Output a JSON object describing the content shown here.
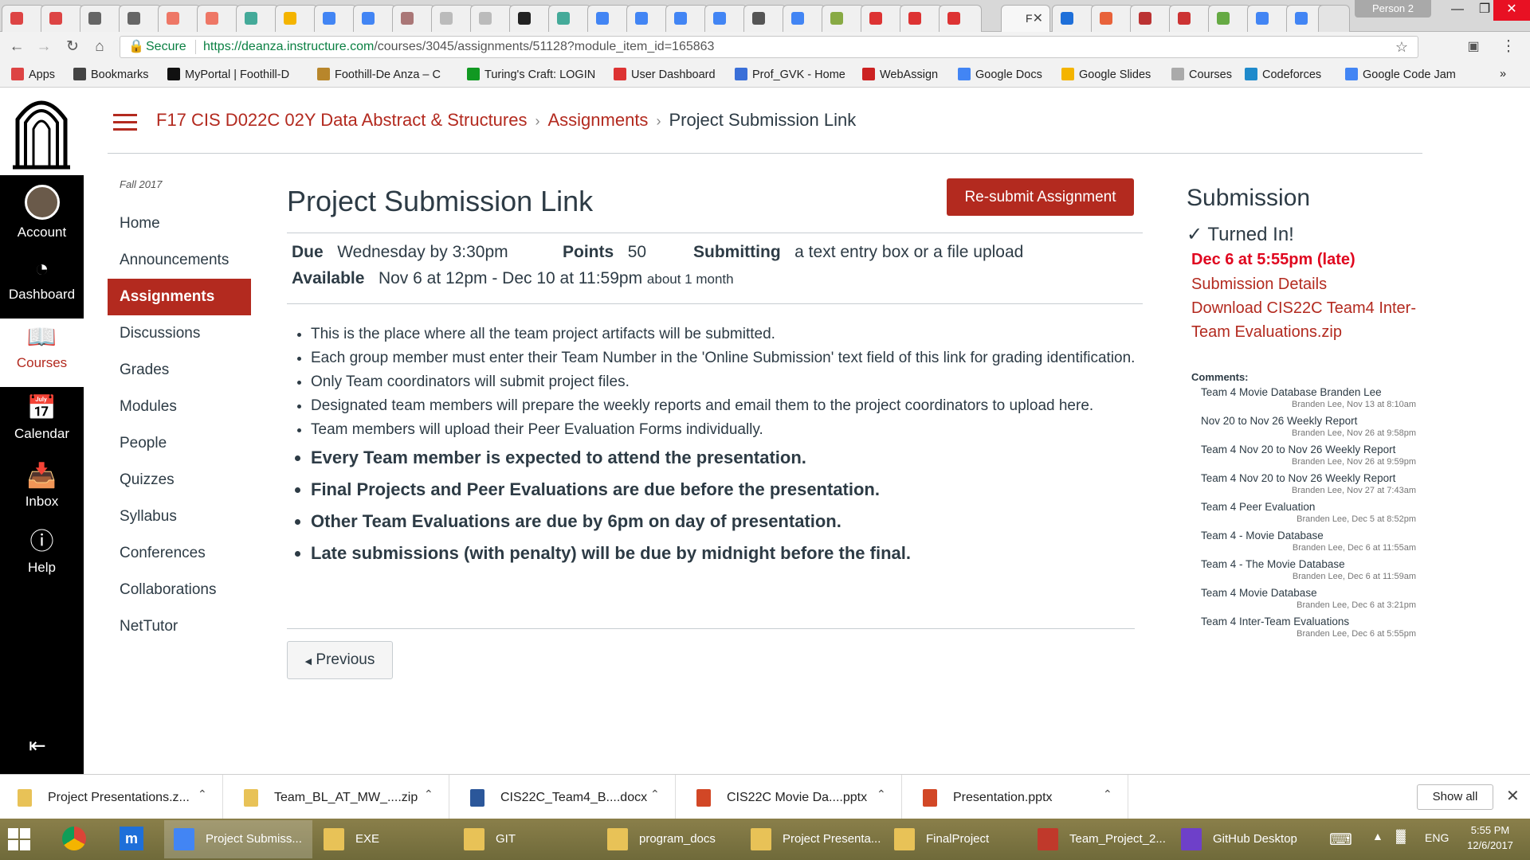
{
  "browser": {
    "active_tab_title": "F",
    "profile": "Person 2",
    "url_host": "https://deanza.instructure.com",
    "url_path": "/courses/3045/assignments/51128?module_item_id=165863",
    "secure_label": "Secure"
  },
  "bookmarks": [
    {
      "label": "Apps",
      "icon": "apps-grid-icon",
      "color": "#d44"
    },
    {
      "label": "Bookmarks",
      "icon": "star-icon",
      "color": "#444"
    },
    {
      "label": "MyPortal | Foothill-D",
      "icon": "s-logo-icon",
      "color": "#111"
    },
    {
      "label": "Foothill-De Anza – C",
      "icon": "foothill-icon",
      "color": "#b8862b"
    },
    {
      "label": "Turing's Craft: LOGIN",
      "icon": "turing-icon",
      "color": "#119922"
    },
    {
      "label": "User Dashboard",
      "icon": "dashboard-icon",
      "color": "#d33"
    },
    {
      "label": "Prof_GVK - Home",
      "icon": "w-logo-icon",
      "color": "#3a6fd8"
    },
    {
      "label": "WebAssign",
      "icon": "webassign-icon",
      "color": "#c22"
    },
    {
      "label": "Google Docs",
      "icon": "google-docs-icon",
      "color": "#4285f4"
    },
    {
      "label": "Google Slides",
      "icon": "google-slides-icon",
      "color": "#f4b400"
    },
    {
      "label": "Courses",
      "icon": "page-icon",
      "color": "#aaa"
    },
    {
      "label": "Codeforces",
      "icon": "codeforces-icon",
      "color": "#1f8acb"
    },
    {
      "label": "Google Code Jam",
      "icon": "google-icon",
      "color": "#4285f4"
    }
  ],
  "global_nav": {
    "account": "Account",
    "dashboard": "Dashboard",
    "courses": "Courses",
    "calendar": "Calendar",
    "inbox": "Inbox",
    "help": "Help"
  },
  "breadcrumb": {
    "course": "F17 CIS D022C 02Y Data Abstract & Structures",
    "section": "Assignments",
    "current": "Project Submission Link"
  },
  "course_nav": {
    "term": "Fall 2017",
    "items": [
      "Home",
      "Announcements",
      "Assignments",
      "Discussions",
      "Grades",
      "Modules",
      "People",
      "Quizzes",
      "Syllabus",
      "Conferences",
      "Collaborations",
      "NetTutor"
    ],
    "active_index": 2
  },
  "assignment": {
    "title": "Project Submission Link",
    "resubmit_label": "Re-submit Assignment",
    "due_label": "Due",
    "due_value": "Wednesday by 3:30pm",
    "points_label": "Points",
    "points_value": "50",
    "submitting_label": "Submitting",
    "submitting_value": "a text entry box or a file upload",
    "available_label": "Available",
    "available_value": "Nov 6 at 12pm - Dec 10 at 11:59pm",
    "available_duration": "about 1 month",
    "description": [
      "This is the place where all the team project artifacts will be submitted.",
      "Each group member must enter their Team Number in the 'Online Submission' text field of this link for grading identification.",
      "Only Team coordinators will submit project files.",
      "Designated team members will prepare the weekly reports and email them to the project coordinators to upload here.",
      "Team members will upload their Peer Evaluation Forms individually.",
      "Every Team member is expected to attend the presentation.",
      "Final Projects and Peer Evaluations are due before the presentation.",
      "Other Team Evaluations are due by 6pm on day of presentation.",
      "Late submissions (with penalty) will be due by midnight before the final."
    ],
    "previous_label": "Previous"
  },
  "submission": {
    "heading": "Submission",
    "status": "Turned In!",
    "date": "Dec 6 at 5:55pm (late)",
    "details_link": "Submission Details",
    "download_link": "Download CIS22C Team4 Inter-Team Evaluations.zip",
    "comments_label": "Comments:",
    "comments": [
      {
        "text": "Team 4 Movie Database Branden Lee",
        "meta": "Branden Lee, Nov 13 at 8:10am"
      },
      {
        "text": "Nov 20 to Nov 26 Weekly Report",
        "meta": "Branden Lee, Nov 26 at 9:58pm"
      },
      {
        "text": "Team 4 Nov 20 to Nov 26 Weekly Report",
        "meta": "Branden Lee, Nov 26 at 9:59pm"
      },
      {
        "text": "Team 4 Nov 20 to Nov 26 Weekly Report",
        "meta": "Branden Lee, Nov 27 at 7:43am"
      },
      {
        "text": "Team 4 Peer Evaluation",
        "meta": "Branden Lee, Dec 5 at 8:52pm"
      },
      {
        "text": "Team 4 - Movie Database",
        "meta": "Branden Lee, Dec 6 at 11:55am"
      },
      {
        "text": "Team 4 - The Movie Database",
        "meta": "Branden Lee, Dec 6 at 11:59am"
      },
      {
        "text": "Team 4 Movie Database",
        "meta": "Branden Lee, Dec 6 at 3:21pm"
      },
      {
        "text": "Team 4 Inter-Team Evaluations",
        "meta": "Branden Lee, Dec 6 at 5:55pm"
      }
    ]
  },
  "downloads": {
    "items": [
      {
        "name": "Project Presentations.z...",
        "icon": "zip-file-icon",
        "color": "#e8c257"
      },
      {
        "name": "Team_BL_AT_MW_....zip",
        "icon": "zip-file-icon",
        "color": "#e8c257"
      },
      {
        "name": "CIS22C_Team4_B....docx",
        "icon": "word-file-icon",
        "color": "#2b579a"
      },
      {
        "name": "CIS22C Movie Da....pptx",
        "icon": "powerpoint-file-icon",
        "color": "#d24726"
      },
      {
        "name": "Presentation.pptx",
        "icon": "powerpoint-file-icon",
        "color": "#d24726"
      }
    ],
    "show_all": "Show all"
  },
  "taskbar": {
    "items": [
      {
        "label": "Project Submiss...",
        "active": true
      },
      {
        "label": "EXE",
        "active": false
      },
      {
        "label": "GIT",
        "active": false
      },
      {
        "label": "program_docs",
        "active": false
      },
      {
        "label": "Project Presenta...",
        "active": false
      },
      {
        "label": "FinalProject",
        "active": false
      },
      {
        "label": "Team_Project_2...",
        "active": false
      },
      {
        "label": "GitHub Desktop",
        "active": false
      }
    ],
    "lang": "ENG",
    "time": "5:55 PM",
    "date": "12/6/2017"
  },
  "colors": {
    "brand_red": "#b32a1f",
    "late_red": "#e0061f",
    "nav_black": "#000000"
  }
}
